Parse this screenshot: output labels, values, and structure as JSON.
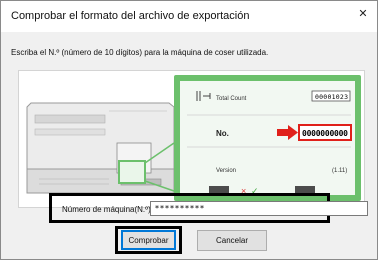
{
  "window": {
    "title": "Comprobar el formato del archivo de exportación",
    "close_glyph": "✕"
  },
  "instruction": "Escriba el N.º (número de 10 dígitos) para la máquina de coser utilizada.",
  "illustration": {
    "total_count_label": "Total Count",
    "total_count_value": "00001023",
    "no_label": "No.",
    "no_value": "0000000000",
    "version_label": "Version",
    "version_value": "(1.11)",
    "colors": {
      "frame": "#6cc06c",
      "highlight": "#e0201a",
      "panel": "#dff0df"
    }
  },
  "field": {
    "label": "Número de máquina(N.º) :",
    "value": "**********"
  },
  "buttons": {
    "ok": "Comprobar",
    "cancel": "Cancelar"
  }
}
